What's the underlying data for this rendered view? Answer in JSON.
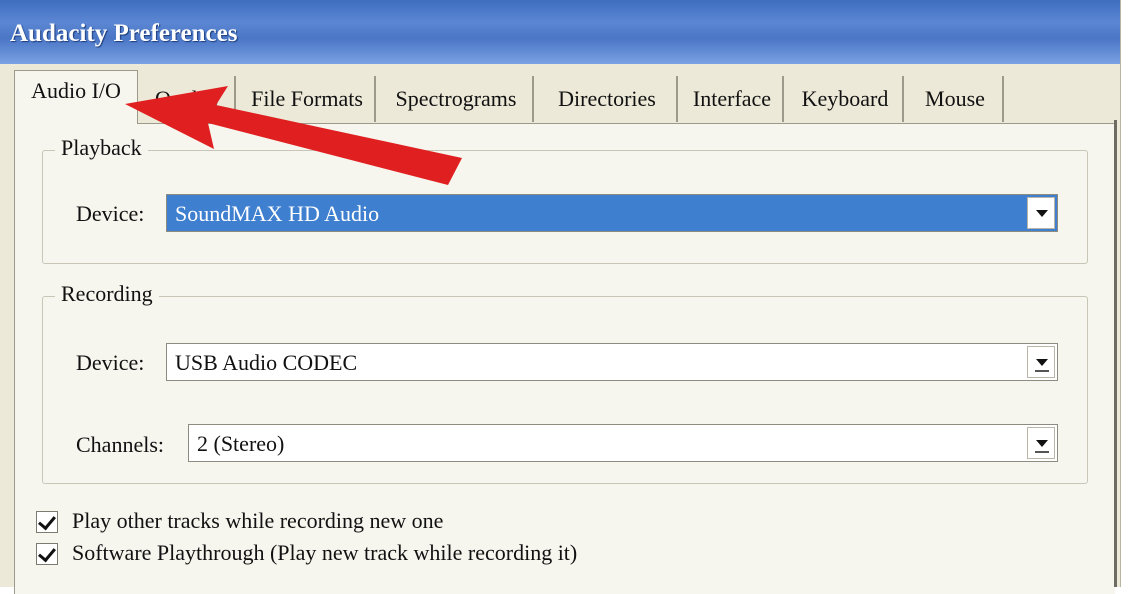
{
  "window": {
    "title": "Audacity Preferences"
  },
  "tabs": [
    {
      "label": "Audio I/O",
      "active": true
    },
    {
      "label": "Quality"
    },
    {
      "label": "File Formats"
    },
    {
      "label": "Spectrograms"
    },
    {
      "label": "Directories"
    },
    {
      "label": "Interface"
    },
    {
      "label": "Keyboard"
    },
    {
      "label": "Mouse"
    }
  ],
  "playback": {
    "group_label": "Playback",
    "device_label": "Device:",
    "device_value": "SoundMAX HD Audio"
  },
  "recording": {
    "group_label": "Recording",
    "device_label": "Device:",
    "device_value": "USB Audio CODEC",
    "channels_label": "Channels:",
    "channels_value": "2 (Stereo)"
  },
  "options": [
    {
      "label": "Play other tracks while recording new one",
      "checked": true
    },
    {
      "label": "Software Playthrough (Play new track while recording it)",
      "checked": true
    }
  ],
  "colors": {
    "titlebar": "#4a76c6",
    "selection": "#3f7fcf",
    "annotation_arrow": "#e02020"
  },
  "icons": [
    "dropdown-arrow-icon",
    "checkmark-icon",
    "red-annotation-arrow"
  ]
}
